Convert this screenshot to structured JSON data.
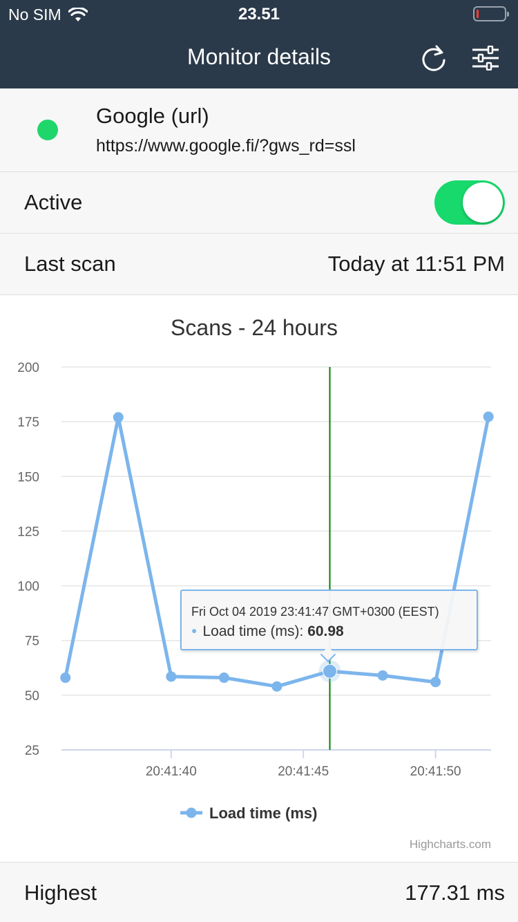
{
  "status_bar": {
    "carrier": "No SIM",
    "wifi_icon": "wifi-icon",
    "time": "23.51",
    "battery_icon": "battery-low-icon",
    "battery_level": 0.05
  },
  "nav": {
    "title": "Monitor details",
    "refresh_icon": "refresh-icon",
    "settings_icon": "sliders-icon"
  },
  "monitor": {
    "name": "Google (url)",
    "url": "https://www.google.fi/?gws_rd=ssl",
    "status_color": "#1fd66a"
  },
  "active": {
    "label": "Active",
    "on": true,
    "toggle_color": "#17d96c"
  },
  "last_scan": {
    "label": "Last scan",
    "value": "Today at 11:51 PM"
  },
  "chart_data": {
    "type": "line",
    "title": "Scans - 24 hours",
    "xlabel": "",
    "ylabel": "",
    "x_unit": "seconds after 20:41:36",
    "series": [
      {
        "name": "Load time (ms)",
        "color": "#7cb5ec",
        "points": [
          {
            "t": "20:41:36",
            "y": 58
          },
          {
            "t": "20:41:38",
            "y": 177
          },
          {
            "t": "20:41:40",
            "y": 58.5
          },
          {
            "t": "20:41:42",
            "y": 58
          },
          {
            "t": "20:41:44",
            "y": 54
          },
          {
            "t": "20:41:46",
            "y": 60.98
          },
          {
            "t": "20:41:48",
            "y": 59
          },
          {
            "t": "20:41:50",
            "y": 56
          },
          {
            "t": "20:41:52",
            "y": 177.31
          }
        ]
      }
    ],
    "ylim": [
      25,
      200
    ],
    "y_ticks": [
      "200",
      "175",
      "150",
      "125",
      "100",
      "75",
      "50",
      "25"
    ],
    "x_ticks": [
      "20:41:40",
      "20:41:45",
      "20:41:50"
    ],
    "grid": true,
    "legend": "bottom-center",
    "credits": "Highcharts.com",
    "crosshair_color": "#008000",
    "highlighted_index": 5,
    "tooltip": {
      "date": "Fri Oct 04 2019 23:41:47 GMT+0300 (EEST)",
      "label": "Load time (ms):",
      "value": "60.98"
    }
  },
  "highest": {
    "label": "Highest",
    "value": "177.31 ms"
  }
}
